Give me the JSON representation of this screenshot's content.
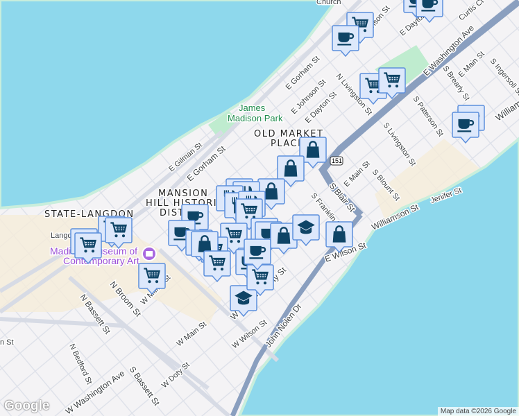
{
  "map": {
    "attribution": "Map data ©2026 Google",
    "logo": "Google",
    "colors": {
      "water": "#8ed8ec",
      "land": "#f4f3f5",
      "park": "#bfeccf",
      "highway": "#8a9fbf",
      "marker_bg": "#dde8fb",
      "marker_border": "#5d8fdc",
      "marker_icon": "#0e4466"
    },
    "labels": {
      "church": "Church",
      "e_johnson_top": "E Johnson St",
      "e_dayton_top": "E Dayton St",
      "curtis": "Curtis Ct",
      "e_gorham": "E Gorham St",
      "e_johnson": "E Johnson St",
      "n_livingston": "N Livingston St",
      "e_washington": "E Washington Ave",
      "s_brearly": "S Brearly St",
      "e_main_right": "E Main St",
      "s_ingersoll": "S Ingersoll St",
      "e_dayton": "E Dayton St",
      "park_line1": "James",
      "park_line2": "Madison Park",
      "old_market_1": "OLD MARKET",
      "old_market_2": "PLACE",
      "s_paterson": "S Paterson St",
      "s_livingston": "S Livingston St",
      "william": "William",
      "route": "151",
      "s_blair": "S Blair St",
      "e_main": "E Main St",
      "s_blount": "S Blount St",
      "jenifer": "Jenifer St",
      "williamson": "Williamson St",
      "s_franklin": "S Franklin St",
      "e_gilman": "E Gilman St",
      "e_gorham_2": "E Gorham St",
      "mansion_1": "MANSION",
      "mansion_2": "HILL HISTORIC",
      "mansion_3": "DISTRICT",
      "state_langdon": "STATE-LANGDON",
      "langdon": "Langdon St",
      "museum_1": "Madison Museum of",
      "museum_2": "Contemporary Art",
      "n_broom": "N Broom St",
      "w_mifflin": "W Mifflin St",
      "n_bassett": "N Bassett St",
      "w_main": "W Main St",
      "w_wilson": "W Wilson St",
      "w_wilson_2": "W Wilson St",
      "e_wilson": "E Wilson St",
      "doty": "Doty St",
      "john_nolen": "John Nolen Dr",
      "n_bedford": "N Bedford St",
      "w_washington": "W Washington Ave",
      "s_bassett": "S Bassett St",
      "w_doty": "W Doty St",
      "gorham_st": "n St"
    },
    "markers": [
      "cup",
      "cup",
      "cart",
      "cup",
      "cart",
      "cart",
      "cup",
      "cup",
      "bag",
      "bag",
      "bag",
      "fork",
      "fork",
      "fork",
      "fork",
      "fork",
      "cart",
      "cart",
      "cart",
      "cup",
      "cup",
      "bag",
      "bag",
      "cart",
      "cart",
      "cart",
      "cart",
      "cart",
      "cup",
      "cup",
      "bag",
      "cap",
      "bag",
      "cup",
      "cart",
      "cap",
      "cart",
      "cup"
    ]
  }
}
